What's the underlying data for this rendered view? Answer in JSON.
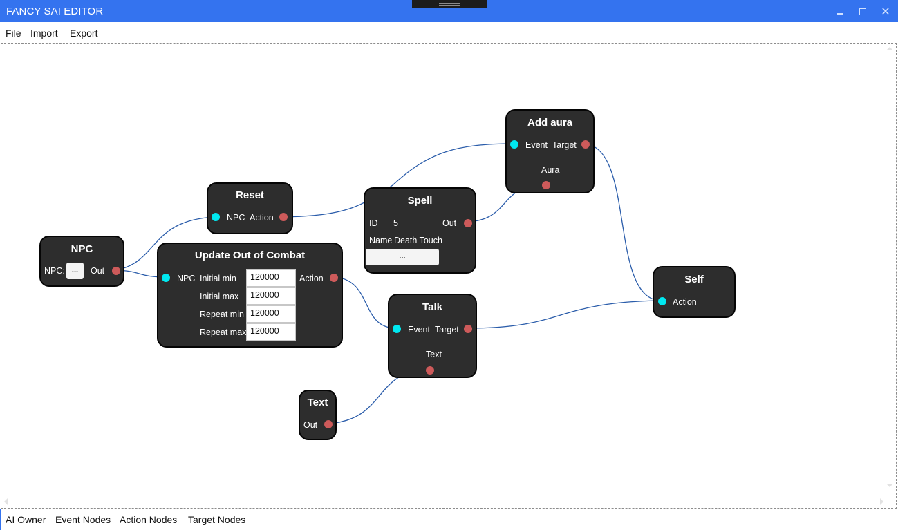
{
  "window": {
    "title": "FANCY SAI EDITOR",
    "controls": [
      "minimize",
      "maximize",
      "close"
    ]
  },
  "menu": {
    "items": [
      "File",
      "Import",
      "Export"
    ]
  },
  "colors": {
    "titlebar": "#3473ef",
    "node_bg": "#2d2d2d",
    "input_port": "#00e8f0",
    "output_port": "#cd5a5a",
    "wire": "#2a5caa"
  },
  "nodes": {
    "npc": {
      "title": "NPC",
      "field_label": "NPC:",
      "button_label": "...",
      "out_label": "Out"
    },
    "reset": {
      "title": "Reset",
      "in_label": "NPC",
      "out_label": "Action"
    },
    "update_ooc": {
      "title": "Update Out of Combat",
      "in_label": "NPC",
      "out_label": "Action",
      "fields": [
        {
          "label": "Initial min",
          "value": "120000"
        },
        {
          "label": "Initial max",
          "value": "120000"
        },
        {
          "label": "Repeat min",
          "value": "120000"
        },
        {
          "label": "Repeat max",
          "value": "120000"
        }
      ]
    },
    "spell": {
      "title": "Spell",
      "id_label": "ID",
      "id_value": "5",
      "out_label": "Out",
      "name_label": "Name",
      "name_value": "Death Touch",
      "button_label": "..."
    },
    "add_aura": {
      "title": "Add aura",
      "in_label": "Event",
      "out_label": "Target",
      "param_label": "Aura"
    },
    "talk": {
      "title": "Talk",
      "in_label": "Event",
      "out_label": "Target",
      "param_label": "Text"
    },
    "text": {
      "title": "Text",
      "out_label": "Out"
    },
    "self": {
      "title": "Self",
      "in_label": "Action"
    }
  },
  "connections": [
    {
      "from": "npc.out",
      "to": "reset.npc"
    },
    {
      "from": "npc.out",
      "to": "update_ooc.npc"
    },
    {
      "from": "reset.action",
      "to": "add_aura.event"
    },
    {
      "from": "spell.out",
      "to": "add_aura.aura"
    },
    {
      "from": "update_ooc.action",
      "to": "talk.event"
    },
    {
      "from": "text.out",
      "to": "talk.text"
    },
    {
      "from": "add_aura.target",
      "to": "self.action"
    },
    {
      "from": "talk.target",
      "to": "self.action"
    }
  ],
  "tabs": [
    "AI Owner",
    "Event Nodes",
    "Action Nodes",
    "Target Nodes"
  ]
}
